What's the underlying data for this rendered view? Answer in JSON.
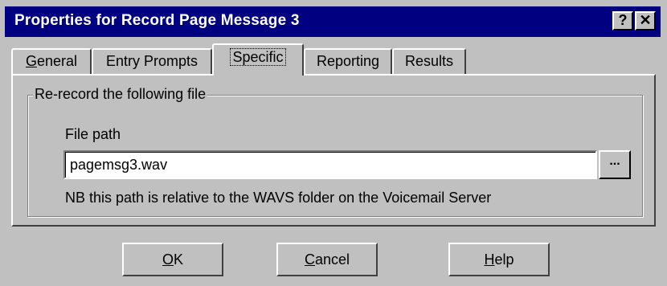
{
  "window": {
    "title": "Properties for Record Page Message 3",
    "help_button": "?",
    "close_button": "✕"
  },
  "tabs": [
    {
      "label": "General",
      "mnemonic": "G",
      "rest": "eneral",
      "active": false
    },
    {
      "label": "Entry Prompts",
      "active": false
    },
    {
      "label": "Specific",
      "active": true
    },
    {
      "label": "Reporting",
      "active": false
    },
    {
      "label": "Results",
      "active": false
    }
  ],
  "group": {
    "legend": "Re-record the following file",
    "file_path_label": "File path",
    "file_path_value": "pagemsg3.wav",
    "browse_label": "...",
    "note": "NB this path is relative to the WAVS folder on the Voicemail Server"
  },
  "buttons": {
    "ok": {
      "mnemonic": "O",
      "rest": "K"
    },
    "cancel": {
      "mnemonic": "C",
      "rest": "ancel"
    },
    "help": {
      "mnemonic": "H",
      "rest": "elp"
    }
  },
  "colors": {
    "titlebar": "#000080",
    "face": "#c0c0c0"
  }
}
